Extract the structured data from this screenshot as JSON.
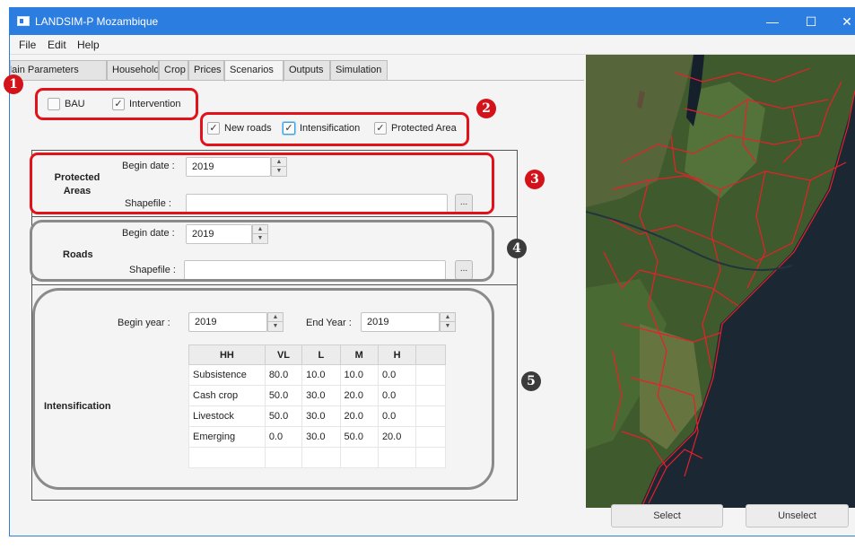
{
  "window": {
    "title": "LANDSIM-P Mozambique",
    "minimize": "—",
    "maximize": "☐",
    "close": "✕"
  },
  "menu": [
    "File",
    "Edit",
    "Help"
  ],
  "tabs": [
    "Main Parameters",
    "Household",
    "Crop",
    "Prices",
    "Scenarios",
    "Outputs",
    "Simulation"
  ],
  "active_tab": "Scenarios",
  "scenario": {
    "bau": {
      "label": "BAU",
      "checked": false
    },
    "intervention": {
      "label": "Intervention",
      "checked": true
    },
    "new_roads": {
      "label": "New roads",
      "checked": true
    },
    "intensification": {
      "label": "Intensification",
      "checked": true
    },
    "protected_area": {
      "label": "Protected Area",
      "checked": true
    }
  },
  "protected": {
    "title_line1": "Protected",
    "title_line2": "Areas",
    "begin_label": "Begin date :",
    "begin_value": "2019",
    "shapefile_label": "Shapefile :",
    "shapefile_value": "",
    "browse": "..."
  },
  "roads": {
    "title": "Roads",
    "begin_label": "Begin date :",
    "begin_value": "2019",
    "shapefile_label": "Shapefile :",
    "shapefile_value": "",
    "browse": "..."
  },
  "intens": {
    "title": "Intensification",
    "begin_label": "Begin year :",
    "begin_value": "2019",
    "end_label": "End Year :",
    "end_value": "2019",
    "columns": [
      "HH",
      "VL",
      "L",
      "M",
      "H"
    ],
    "rows": [
      [
        "Subsistence",
        "80.0",
        "10.0",
        "10.0",
        "0.0"
      ],
      [
        "Cash crop",
        "50.0",
        "30.0",
        "20.0",
        "0.0"
      ],
      [
        "Livestock",
        "50.0",
        "30.0",
        "20.0",
        "0.0"
      ],
      [
        "Emerging",
        "0.0",
        "30.0",
        "50.0",
        "20.0"
      ]
    ]
  },
  "markers": [
    "1",
    "2",
    "3",
    "4",
    "5"
  ],
  "buttons": {
    "select": "Select",
    "unselect": "Unselect"
  },
  "icons": {
    "check": "✓",
    "spin_up": "▲",
    "spin_down": "▼"
  },
  "colors": {
    "titlebar": "#2c7de0",
    "annotation_red": "#e3121a",
    "annotation_gray": "#8a8a8a",
    "map_borders": "#e8202a"
  }
}
